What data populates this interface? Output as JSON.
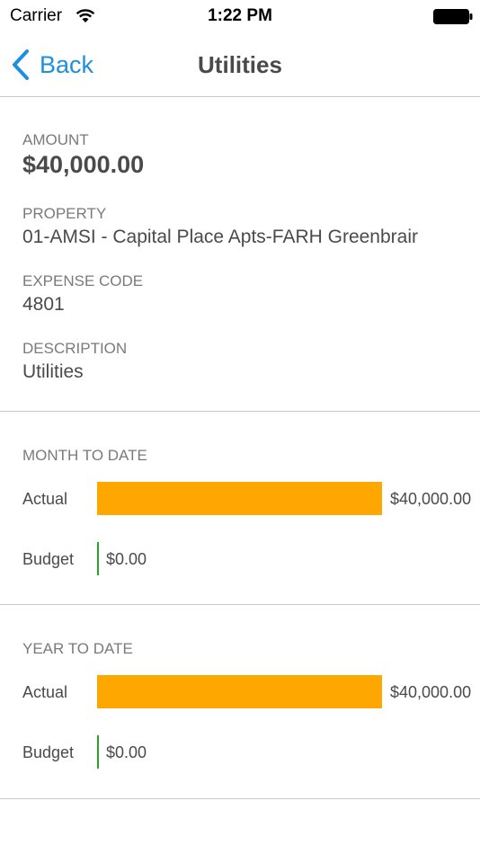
{
  "status_bar": {
    "carrier": "Carrier",
    "time": "1:22 PM",
    "icons": [
      "wifi-icon",
      "battery-icon"
    ]
  },
  "nav": {
    "back_label": "Back",
    "back_icon": "chevron-left-icon",
    "title": "Utilities",
    "accent_color": "#1d8fe1"
  },
  "details": {
    "amount_label": "AMOUNT",
    "amount_value": "$40,000.00",
    "property_label": "PROPERTY",
    "property_value": "01-AMSI - Capital Place Apts-FARH Greenbrair",
    "expense_code_label": "EXPENSE CODE",
    "expense_code_value": "4801",
    "description_label": "DESCRIPTION",
    "description_value": "Utilities"
  },
  "month_to_date": {
    "heading": "MONTH TO DATE",
    "actual_label": "Actual",
    "actual_value": "$40,000.00",
    "actual_amount": 40000,
    "budget_label": "Budget",
    "budget_value": "$0.00",
    "budget_amount": 0
  },
  "year_to_date": {
    "heading": "YEAR TO DATE",
    "actual_label": "Actual",
    "actual_value": "$40,000.00",
    "actual_amount": 40000,
    "budget_label": "Budget",
    "budget_value": "$0.00",
    "budget_amount": 0
  },
  "colors": {
    "actual_bar": "#fda700",
    "budget_line": "#2ca02c"
  }
}
